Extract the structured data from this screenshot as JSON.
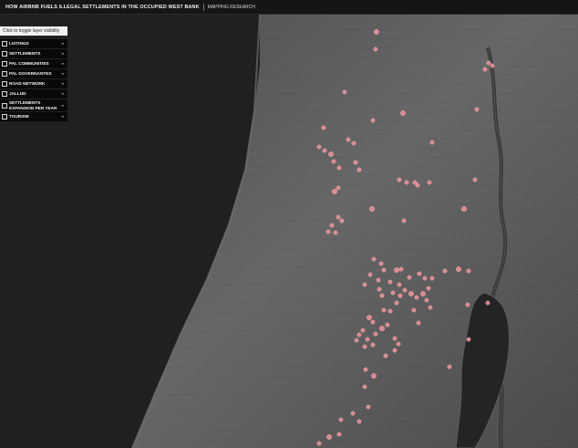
{
  "header": {
    "title": "HOW AIRBNB FUELS ILLEGAL SETTLEMENTS IN THE OCCUPIED WEST BANK",
    "subtitle": "MAPPING RESEARCH"
  },
  "panel": {
    "toggle_note": "Click to toggle layer visibility",
    "layers": [
      {
        "label": "LISTINGS",
        "checked": false
      },
      {
        "label": "SETTLEMENTS",
        "checked": false
      },
      {
        "label": "PAL COMMUNITIES",
        "checked": false
      },
      {
        "label": "PAL GOVERNANTES",
        "checked": false
      },
      {
        "label": "ROAD NETWORK",
        "checked": false
      },
      {
        "label": "JALLUD",
        "checked": false
      },
      {
        "label": "SETTLEMENTS\nEXPANSION PER YEAR",
        "checked": false
      },
      {
        "label": "TOURISM",
        "checked": false
      }
    ]
  },
  "icons": {
    "checkbox": "checkbox-icon",
    "chevron": "chevron-down-icon"
  },
  "colors": {
    "background": "#1e1e1e",
    "sea": "#1f1f1f",
    "land": "#5b5b5b",
    "listing_marker": "#f28f96"
  }
}
